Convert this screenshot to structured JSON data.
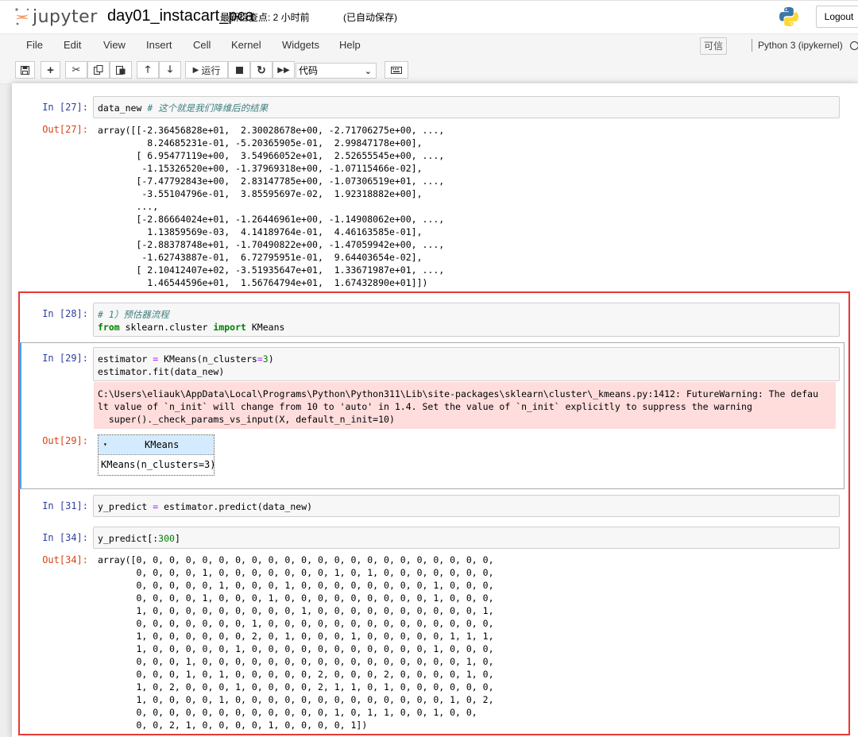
{
  "header": {
    "logo_text": "jupyter",
    "notebook_title": "day01_instacart_pca",
    "checkpoint": "最新检查点: 2 小时前",
    "autosave": "(已自动保存)",
    "logout_label": "Logout"
  },
  "menubar": {
    "items": [
      "File",
      "Edit",
      "View",
      "Insert",
      "Cell",
      "Kernel",
      "Widgets",
      "Help"
    ],
    "trusted_label": "可信",
    "kernel_name": "Python 3 (ipykernel)"
  },
  "toolbar": {
    "run_label": "运行",
    "cell_type": "代码"
  },
  "cells": {
    "c27": {
      "in_prompt": "In  [27]:",
      "code": "data_new",
      "comment": "# 这个就是我们降维后的结果",
      "out_prompt": "Out[27]:",
      "output": "array([[-2.36456828e+01,  2.30028678e+00, -2.71706275e+00, ...,\n         8.24685231e-01, -5.20365905e-01,  2.99847178e+00],\n       [ 6.95477119e+00,  3.54966052e+01,  2.52655545e+00, ...,\n        -1.15326520e+00, -1.37969318e+00, -1.07115466e-02],\n       [-7.47792843e+00,  2.83147785e+00, -1.07306519e+01, ...,\n        -3.55104796e-01,  3.85595697e-02,  1.92318882e+00],\n       ...,\n       [-2.86664024e+01, -1.26446961e+00, -1.14908062e+00, ...,\n         1.13859569e-03,  4.14189764e-01,  4.46163585e-01],\n       [-2.88378748e+01, -1.70490822e+00, -1.47059942e+00, ...,\n        -1.62743887e-01,  6.72795951e-01,  9.64403654e-02],\n       [ 2.10412407e+02, -3.51935647e+01,  1.33671987e+01, ...,\n         1.46544596e+01,  1.56764794e+01,  1.67432890e+01]])"
    },
    "c28": {
      "in_prompt": "In  [28]:",
      "comment": "# 1）预估器流程",
      "kw_from": "from",
      "module": " sklearn.cluster ",
      "kw_import": "import",
      "name": " KMeans"
    },
    "c29": {
      "in_prompt": "In  [29]:",
      "line1_a": "estimator ",
      "line1_op": "=",
      "line1_b": " KMeans(n_clusters",
      "line1_op2": "=",
      "line1_num": "3",
      "line1_c": ")",
      "line2": "estimator.fit(data_new)",
      "warning": "C:\\Users\\eliauk\\AppData\\Local\\Programs\\Python\\Python311\\Lib\\site-packages\\sklearn\\cluster\\_kmeans.py:1412: FutureWarning: The defau\nlt value of `n_init` will change from 10 to 'auto' in 1.4. Set the value of `n_init` explicitly to suppress the warning\n  super()._check_params_vs_input(X, default_n_init=10)",
      "out_prompt": "Out[29]:",
      "kmeans_title": "KMeans",
      "kmeans_repr": "KMeans(n_clusters=3)"
    },
    "c31": {
      "in_prompt": "In  [31]:",
      "code_a": "y_predict ",
      "code_op": "=",
      "code_b": " estimator.predict(data_new)"
    },
    "c34": {
      "in_prompt": "In  [34]:",
      "code_a": "y_predict[:",
      "code_num": "300",
      "code_b": "]",
      "out_prompt": "Out[34]:",
      "output": "array([0, 0, 0, 0, 0, 0, 0, 0, 0, 0, 0, 0, 0, 0, 0, 0, 0, 0, 0, 0, 0, 0,\n       0, 0, 0, 0, 1, 0, 0, 0, 0, 0, 0, 0, 1, 0, 1, 0, 0, 0, 0, 0, 0, 0,\n       0, 0, 0, 0, 0, 1, 0, 0, 0, 1, 0, 0, 0, 0, 0, 0, 0, 0, 1, 0, 0, 0,\n       0, 0, 0, 0, 1, 0, 0, 0, 1, 0, 0, 0, 0, 0, 0, 0, 0, 0, 1, 0, 0, 0,\n       1, 0, 0, 0, 0, 0, 0, 0, 0, 0, 1, 0, 0, 0, 0, 0, 0, 0, 0, 0, 0, 1,\n       0, 0, 0, 0, 0, 0, 0, 1, 0, 0, 0, 0, 0, 0, 0, 0, 0, 0, 0, 0, 0, 0,\n       1, 0, 0, 0, 0, 0, 0, 2, 0, 1, 0, 0, 0, 1, 0, 0, 0, 0, 0, 1, 1, 1,\n       1, 0, 0, 0, 0, 0, 1, 0, 0, 0, 0, 0, 0, 0, 0, 0, 0, 0, 1, 0, 0, 0,\n       0, 0, 0, 1, 0, 0, 0, 0, 0, 0, 0, 0, 0, 0, 0, 0, 0, 0, 0, 0, 1, 0,\n       0, 0, 0, 1, 0, 1, 0, 0, 0, 0, 0, 2, 0, 0, 0, 2, 0, 0, 0, 0, 1, 0,\n       1, 0, 2, 0, 0, 0, 1, 0, 0, 0, 0, 2, 1, 1, 0, 1, 0, 0, 0, 0, 0, 0,\n       1, 0, 0, 0, 0, 1, 0, 0, 0, 0, 0, 0, 0, 0, 0, 0, 0, 0, 0, 1, 0, 2,\n       0, 0, 0, 0, 0, 0, 0, 0, 0, 0, 0, 0, 1, 0, 1, 1, 0, 0, 1, 0, 0,\n       0, 0, 2, 1, 0, 0, 0, 0, 1, 0, 0, 0, 0, 1])"
    }
  }
}
